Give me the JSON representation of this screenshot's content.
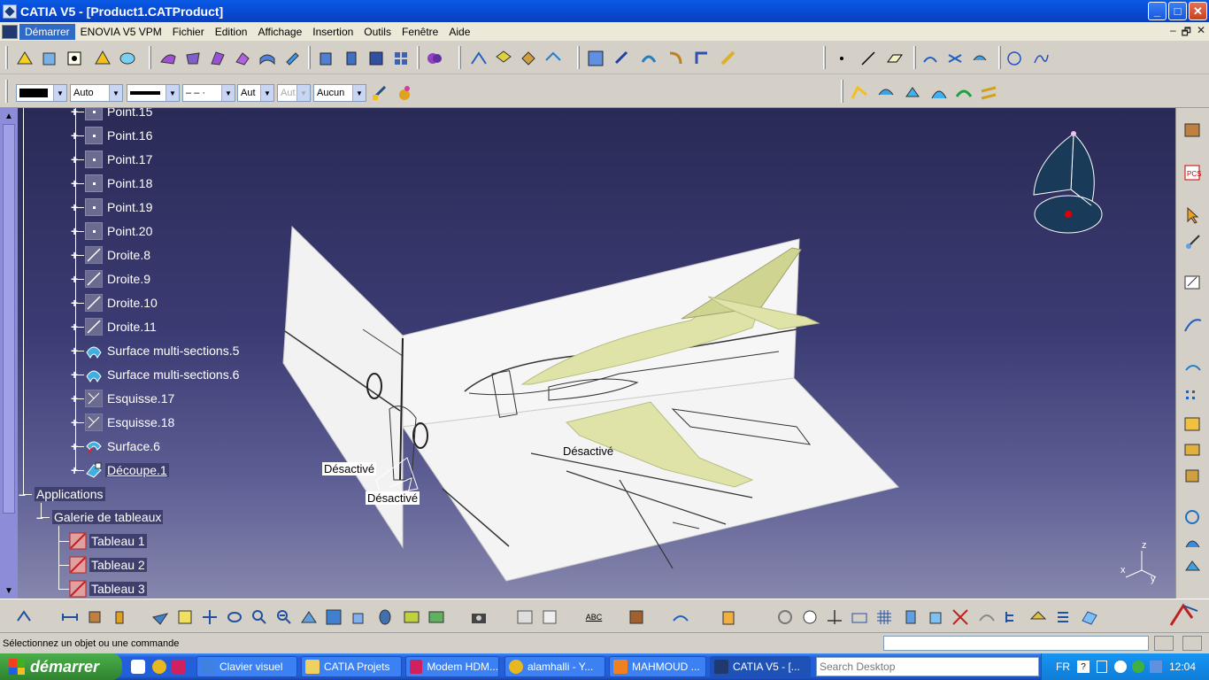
{
  "window": {
    "title": "CATIA V5 - [Product1.CATProduct]",
    "min": "_",
    "max": "□",
    "close": "✕"
  },
  "menu": {
    "items": [
      "Démarrer",
      "ENOVIA V5 VPM",
      "Fichier",
      "Edition",
      "Affichage",
      "Insertion",
      "Outils",
      "Fenêtre",
      "Aide"
    ],
    "mdi": [
      "–",
      "🗗",
      "✕"
    ]
  },
  "properties_toolbar": {
    "color": "",
    "transparency": "Auto",
    "line_weight": "",
    "line_type": "– – ·",
    "layer": "Aut",
    "layer_disabled": "Aut",
    "filter": "Aucun"
  },
  "tree": {
    "nodes": [
      {
        "label": "Point.15",
        "icon": "point-icon"
      },
      {
        "label": "Point.16",
        "icon": "point-icon"
      },
      {
        "label": "Point.17",
        "icon": "point-icon"
      },
      {
        "label": "Point.18",
        "icon": "point-icon"
      },
      {
        "label": "Point.19",
        "icon": "point-icon"
      },
      {
        "label": "Point.20",
        "icon": "point-icon"
      },
      {
        "label": "Droite.8",
        "icon": "line-icon"
      },
      {
        "label": "Droite.9",
        "icon": "line-icon"
      },
      {
        "label": "Droite.10",
        "icon": "line-icon"
      },
      {
        "label": "Droite.11",
        "icon": "line-icon"
      },
      {
        "label": "Surface multi-sections.5",
        "icon": "multi-section-surface-icon"
      },
      {
        "label": "Surface multi-sections.6",
        "icon": "multi-section-surface-icon"
      },
      {
        "label": "Esquisse.17",
        "icon": "sketch-icon"
      },
      {
        "label": "Esquisse.18",
        "icon": "sketch-icon"
      },
      {
        "label": "Surface.6",
        "icon": "surface-icon"
      },
      {
        "label": "Découpe.1",
        "icon": "split-icon"
      }
    ],
    "applications": "Applications",
    "gallery": "Galerie de tableaux",
    "tables": [
      "Tableau 1",
      "Tableau 2",
      "Tableau 3"
    ]
  },
  "viewport": {
    "deactivated_labels": [
      "Désactivé",
      "Désactivé",
      "Désactivé"
    ],
    "axis_labels": {
      "z": "z",
      "y": "y",
      "x": "x"
    }
  },
  "bottom_toolbar": {
    "spell_label": "ABC"
  },
  "status": {
    "message": "Sélectionnez un objet ou une commande"
  },
  "taskbar": {
    "start": "démarrer",
    "tasks": [
      "Clavier visuel",
      "CATIA Projets",
      "Modem HDM...",
      "alamhalli - Y...",
      "MAHMOUD ...",
      "CATIA V5 - [..."
    ],
    "search_placeholder": "Search Desktop",
    "lang": "FR",
    "clock": "12:04"
  },
  "colors": {
    "accent": "#316ac5",
    "viewport_top": "#2a2a56",
    "viewport_bottom": "#8687ad",
    "surface": "#dfe3a8"
  }
}
